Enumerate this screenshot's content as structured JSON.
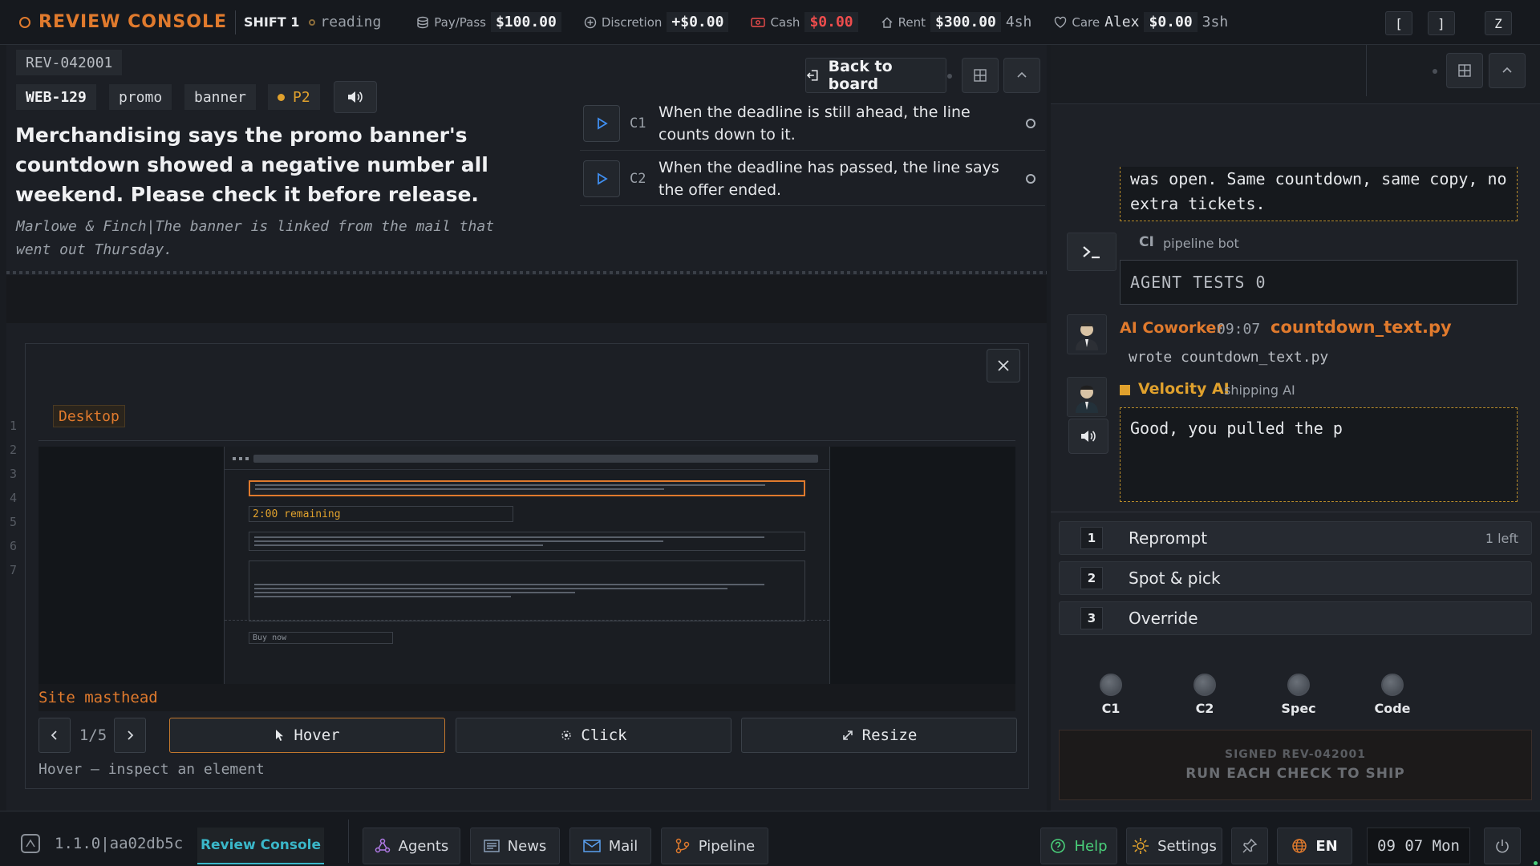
{
  "topbar": {
    "brand": "REVIEW CONSOLE",
    "shift": "SHIFT 1",
    "status": "reading",
    "metrics": [
      {
        "label": "Pay/Pass",
        "value": "$100.00",
        "extra": "",
        "icon": "stack-icon"
      },
      {
        "label": "Discretion",
        "value": "+$0.00",
        "extra": "",
        "icon": "plus-circle-icon"
      },
      {
        "label": "Cash",
        "value": "$0.00",
        "extra": "",
        "icon": "cash-icon"
      },
      {
        "label": "Rent",
        "value": "$300.00",
        "extra": "4sh",
        "icon": "house-icon"
      },
      {
        "label": "Care",
        "name": "Alex",
        "value": "$0.00",
        "extra": "3sh",
        "icon": "heart-icon"
      }
    ],
    "keys": [
      "[",
      "]",
      "Z"
    ]
  },
  "ticket": {
    "id": "REV-042001",
    "tags": [
      "WEB-129",
      "promo",
      "banner"
    ],
    "priority": "P2",
    "title": "Merchandising says the promo banner's countdown showed a negative number all weekend. Please check it before release.",
    "note": "Marlowe & Finch|The banner is linked from the mail that went out Thursday.",
    "back_label": "Back to board",
    "checks": [
      {
        "id": "C1",
        "text": "When the deadline is still ahead, the line counts down to it."
      },
      {
        "id": "C2",
        "text": "When the deadline has passed, the line says the offer ended."
      }
    ]
  },
  "preview": {
    "device": "Desktop",
    "countdown_text": "2:00 remaining",
    "buy_label": "Buy now",
    "element_label": "Site masthead",
    "page": "1/5",
    "tools": [
      "Hover",
      "Click",
      "Resize"
    ],
    "hint": "Hover — inspect an element",
    "line_numbers": [
      "1",
      "2",
      "3",
      "4",
      "5",
      "6",
      "7"
    ]
  },
  "chat": {
    "prev_message": "was open. Same countdown, same copy, no extra tickets.",
    "ci_tag": "CI",
    "ci_name": "pipeline bot",
    "ci_message": "AGENT TESTS 0",
    "coworker_name": "AI Coworker",
    "coworker_time": "09:07",
    "coworker_file": "countdown_text.py",
    "coworker_message": "wrote countdown_text.py",
    "velocity_name": "Velocity AI",
    "velocity_role": "shipping AI",
    "velocity_message": "Good, you pulled the p"
  },
  "actions": [
    {
      "num": "1",
      "label": "Reprompt",
      "note": "1 left"
    },
    {
      "num": "2",
      "label": "Spot & pick",
      "note": ""
    },
    {
      "num": "3",
      "label": "Override",
      "note": ""
    }
  ],
  "knobs": [
    "C1",
    "C2",
    "Spec",
    "Code"
  ],
  "sign": {
    "line1": "SIGNED REV-042001",
    "line2": "RUN EACH CHECK TO SHIP"
  },
  "bottombar": {
    "version": "1.1.0|aa02db5c",
    "active_tab": "Review Console",
    "nav": [
      "Agents",
      "News",
      "Mail",
      "Pipeline"
    ],
    "help": "Help",
    "settings": "Settings",
    "lang": "EN",
    "clock": "09 07 Mon"
  },
  "colors": {
    "accent": "#e07a2d",
    "bg": "#191c21",
    "danger": "#ef4d4d",
    "teal": "#3ab7c9",
    "gold": "#e0a12d"
  }
}
